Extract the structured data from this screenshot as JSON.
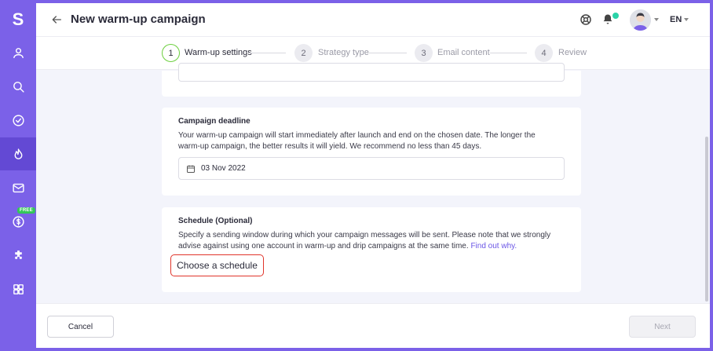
{
  "sidebar": {
    "logo": "S",
    "free_badge": "FREE",
    "items": [
      {
        "icon": "user-icon"
      },
      {
        "icon": "search-icon"
      },
      {
        "icon": "check-circle-icon"
      },
      {
        "icon": "flame-icon",
        "active": true
      },
      {
        "icon": "mail-icon"
      },
      {
        "icon": "dollar-icon"
      },
      {
        "icon": "puzzle-icon"
      },
      {
        "icon": "apps-icon"
      }
    ]
  },
  "header": {
    "title": "New warm-up campaign",
    "language": "EN"
  },
  "stepper": {
    "steps": [
      {
        "number": "1",
        "label": "Warm-up settings",
        "active": true
      },
      {
        "number": "2",
        "label": "Strategy type"
      },
      {
        "number": "3",
        "label": "Email content"
      },
      {
        "number": "4",
        "label": "Review"
      }
    ]
  },
  "deadline": {
    "title": "Campaign deadline",
    "description": "Your warm-up campaign will start immediately after launch and end on the chosen date. The longer the warm-up campaign, the better results it will yield. We recommend no less than 45 days.",
    "date_value": "03 Nov 2022"
  },
  "schedule": {
    "title": "Schedule (Optional)",
    "description": "Specify a sending window during which your campaign messages will be sent. Please note that we strongly advise against using one account in warm-up and drip campaigns at the same time.",
    "link_text": "Find out why.",
    "button_label": "Choose a schedule"
  },
  "footer": {
    "cancel_label": "Cancel",
    "next_label": "Next"
  },
  "colors": {
    "brand": "#7b61e8",
    "active_step": "#6ccf3f",
    "highlight": "#e0352b",
    "notification": "#2bd3a8"
  }
}
